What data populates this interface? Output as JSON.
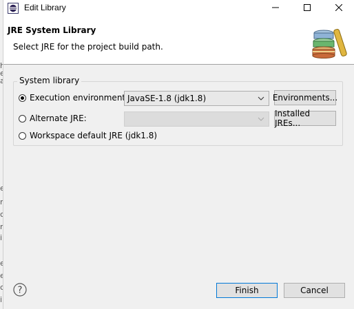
{
  "window": {
    "title": "Edit Library",
    "controls": [
      "minimize-icon",
      "maximize-icon",
      "close-icon"
    ]
  },
  "header": {
    "title": "JRE System Library",
    "message": "Select JRE for the project build path.",
    "image": "books-icon"
  },
  "group": {
    "legend": "System library",
    "options": [
      {
        "label": "Execution environment:",
        "selected": true,
        "combo_value": "JavaSE-1.8 (jdk1.8)",
        "combo_enabled": true,
        "button": "Environments..."
      },
      {
        "label": "Alternate JRE:",
        "selected": false,
        "combo_value": "",
        "combo_enabled": false,
        "button": "Installed JREs..."
      },
      {
        "label": "Workspace default JRE (jdk1.8)",
        "selected": false
      }
    ]
  },
  "footer": {
    "help_icon": "help-icon",
    "finish": "Finish",
    "cancel": "Cancel"
  },
  "background_glyphs": [
    "h",
    "e",
    "a",
    "e",
    "r",
    "c",
    "n",
    "i",
    "e",
    "e",
    "c",
    "i"
  ],
  "colors": {
    "accent": "#0078d7",
    "dialog_bg": "#f0f0f0",
    "banner_bg": "#ffffff"
  }
}
